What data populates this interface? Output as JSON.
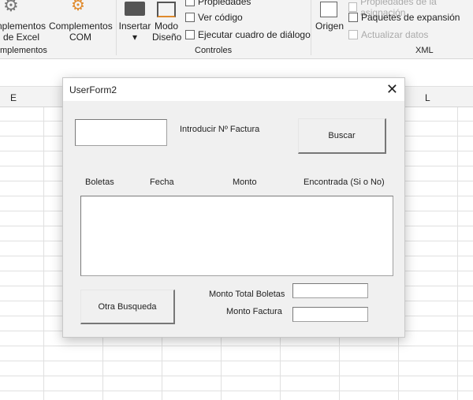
{
  "ribbon": {
    "complementos_excel": "nplementos de Excel",
    "complementos_com": "Complementos COM",
    "group_complementos": "mplementos",
    "insertar": "Insertar",
    "modo_diseno": "Modo Diseño",
    "propiedades": "Propiedades",
    "ver_codigo": "Ver código",
    "ejecutar": "Ejecutar cuadro de diálogo",
    "group_controles": "Controles",
    "origen": "Origen",
    "propiedades_asignacion": "Propiedades de la asignación",
    "paquetes": "Paquetes de expansión",
    "actualizar": "Actualizar datos",
    "group_xml": "XML"
  },
  "columns": {
    "e": "E",
    "l": "L"
  },
  "dialog": {
    "title": "UserForm2",
    "factura_label": "Introducir Nº Factura",
    "factura_value": "",
    "buscar": "Buscar",
    "headers": [
      "Boletas",
      "Fecha",
      "Monto",
      "Encontrada (Si o No)"
    ],
    "otra_busqueda": "Otra Busqueda",
    "monto_total_label": "Monto Total Boletas",
    "monto_total_value": "",
    "monto_factura_label": "Monto Factura",
    "monto_factura_value": ""
  }
}
